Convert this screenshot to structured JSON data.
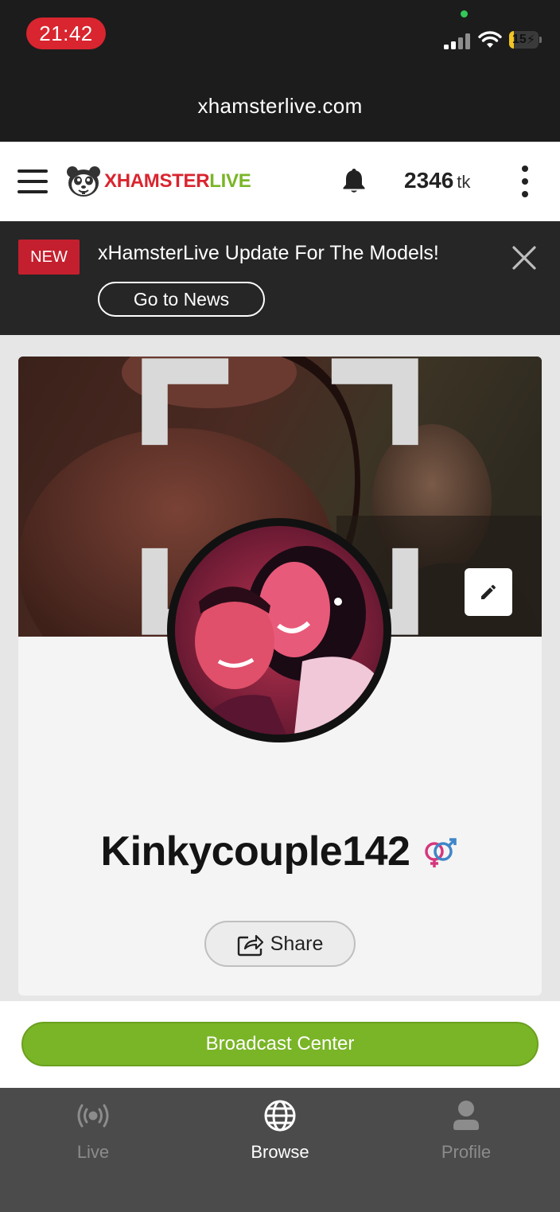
{
  "status_bar": {
    "time": "21:42",
    "battery": "15",
    "battery_level": 0.15
  },
  "browser": {
    "url": "xhamsterlive.com"
  },
  "header": {
    "logo_primary": "XHAMSTER",
    "logo_secondary": "LIVE",
    "tokens_value": "2346",
    "tokens_unit": "tk"
  },
  "news_banner": {
    "badge": "NEW",
    "message": "xHamsterLive Update For The Models!",
    "button_label": "Go to News"
  },
  "profile": {
    "username": "Kinkycouple142",
    "share_label": "Share"
  },
  "broadcast": {
    "label": "Broadcast Center"
  },
  "nav": {
    "items": [
      {
        "label": "Live",
        "icon": "live-broadcast-icon"
      },
      {
        "label": "Browse",
        "icon": "globe-icon",
        "active": true
      },
      {
        "label": "Profile",
        "icon": "user-icon"
      }
    ]
  },
  "colors": {
    "brand_red": "#d9252f",
    "brand_green": "#7ab527",
    "banner_bg": "#262626"
  }
}
